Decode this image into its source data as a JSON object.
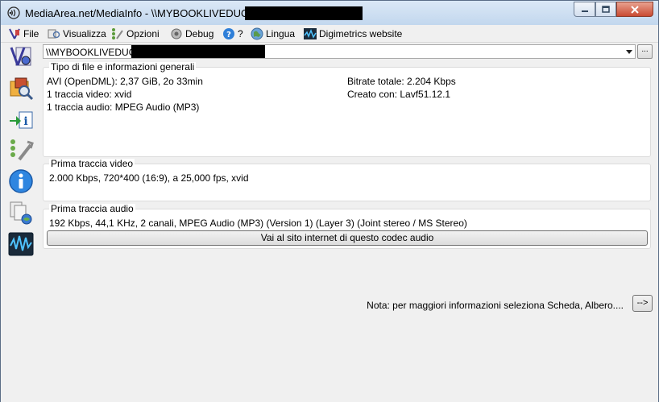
{
  "window": {
    "title": "MediaArea.net/MediaInfo - \\\\MYBOOKLIVEDUO\\"
  },
  "menu": {
    "items": [
      "File",
      "Visualizza",
      "Opzioni",
      "Debug",
      "?",
      "Lingua",
      "Digimetrics website"
    ]
  },
  "toolbar_icons": [
    "open-file-icon",
    "open-folder-icon",
    "export-icon",
    "preferences-icon",
    "about-icon",
    "multiple-files-icon",
    "digimetrics-icon"
  ],
  "file": {
    "path": "\\\\MYBOOKLIVEDUO\\",
    "browse_label": "..."
  },
  "general": {
    "title": "Tipo di file e informazioni generali",
    "container": "AVI (OpenDML): 2,37 GiB, 2o 33min",
    "video_tracks": "1 traccia video: xvid",
    "audio_tracks": "1 traccia audio: MPEG Audio (MP3)",
    "bitrate": "Bitrate totale: 2.204 Kbps",
    "created_with": "Creato con: Lavf51.12.1"
  },
  "video": {
    "title": "Prima traccia video",
    "info": "2.000 Kbps, 720*400 (16:9), a 25,000 fps, xvid"
  },
  "audio": {
    "title": "Prima traccia audio",
    "info": "192 Kbps, 44,1 KHz, 2 canali, MPEG Audio (MP3) (Version 1) (Layer 3) (Joint stereo / MS Stereo)",
    "codec_button": "Vai al sito internet di questo codec audio"
  },
  "footer": {
    "note": "Nota: per maggiori informazioni seleziona Scheda, Albero....",
    "next_button": "-->"
  }
}
